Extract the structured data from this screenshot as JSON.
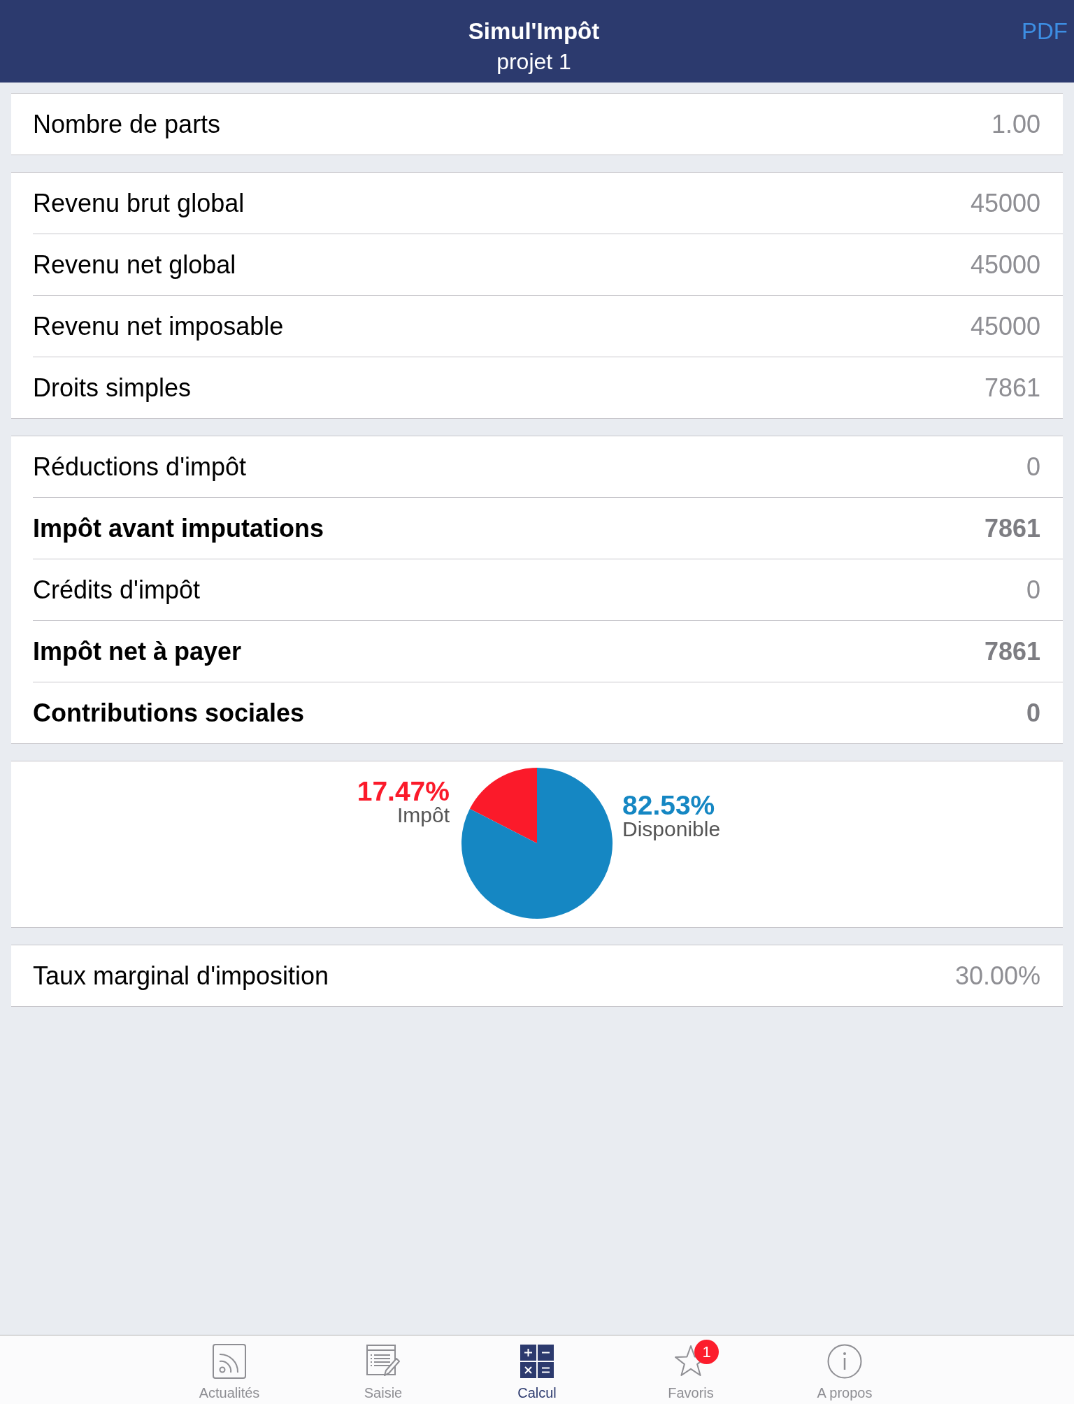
{
  "header": {
    "title": "Simul'Impôt",
    "subtitle": "projet 1",
    "action": "PDF"
  },
  "sections": [
    {
      "kind": "rows",
      "rows": [
        {
          "label": "Nombre de parts",
          "value": "1.00",
          "emphasis": false
        }
      ]
    },
    {
      "kind": "rows",
      "rows": [
        {
          "label": "Revenu brut global",
          "value": "45000",
          "emphasis": false
        },
        {
          "label": "Revenu net global",
          "value": "45000",
          "emphasis": false
        },
        {
          "label": "Revenu net imposable",
          "value": "45000",
          "emphasis": false
        },
        {
          "label": "Droits simples",
          "value": "7861",
          "emphasis": false
        }
      ]
    },
    {
      "kind": "rows",
      "rows": [
        {
          "label": "Réductions d'impôt",
          "value": "0",
          "emphasis": false
        },
        {
          "label": "Impôt avant imputations",
          "value": "7861",
          "emphasis": true
        },
        {
          "label": "Crédits d'impôt",
          "value": "0",
          "emphasis": false
        },
        {
          "label": "Impôt net à payer",
          "value": "7861",
          "emphasis": true
        },
        {
          "label": "Contributions sociales",
          "value": "0",
          "emphasis": true
        }
      ]
    },
    {
      "kind": "chart",
      "chart_data": {
        "type": "pie",
        "categories": [
          "Impôt",
          "Disponible"
        ],
        "values": [
          17.47,
          82.53
        ],
        "value_labels": [
          "17.47%",
          "82.53%"
        ]
      }
    },
    {
      "kind": "rows",
      "rows": [
        {
          "label": "Taux marginal d'imposition",
          "value": "30.00%",
          "emphasis": false
        }
      ]
    }
  ],
  "tab_bar": {
    "tabs": [
      {
        "label": "Actualités",
        "selected": false
      },
      {
        "label": "Saisie",
        "selected": false
      },
      {
        "label": "Calcul",
        "selected": true
      },
      {
        "label": "Favoris",
        "selected": false,
        "badge": "1"
      },
      {
        "label": "A propos",
        "selected": false
      }
    ]
  }
}
